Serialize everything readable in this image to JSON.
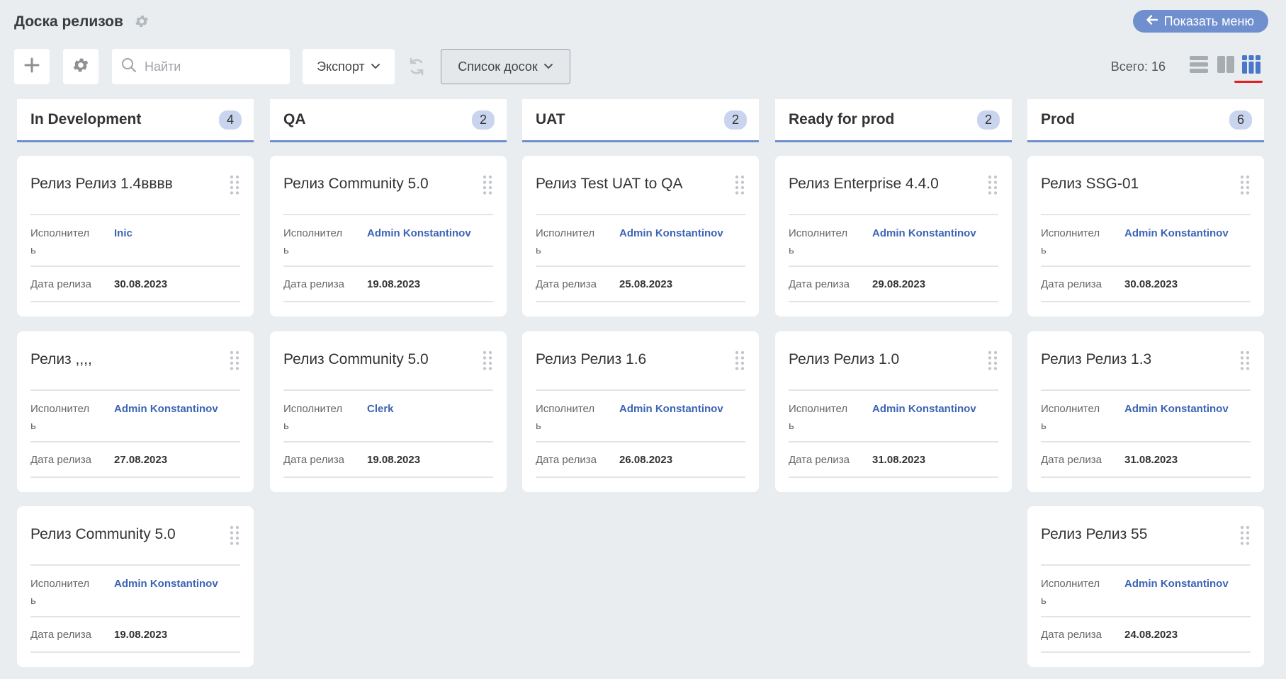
{
  "header": {
    "title": "Доска релизов",
    "show_menu_label": "Показать меню"
  },
  "toolbar": {
    "search_placeholder": "Найти",
    "export_label": "Экспорт",
    "boards_label": "Список досок",
    "total_label": "Всего: 16"
  },
  "labels": {
    "assignee": "Исполнител ь",
    "assignee_line1": "Исполнител",
    "assignee_line2": "ь",
    "release_date": "Дата релиза"
  },
  "columns": [
    {
      "title": "In Development",
      "count": "4",
      "cards": [
        {
          "title": "Релиз Релиз 1.4вввв",
          "assignee": "Inic",
          "date": "30.08.2023"
        },
        {
          "title": "Релиз ,,,,",
          "assignee": "Admin Konstantinov",
          "date": "27.08.2023"
        },
        {
          "title": "Релиз Community 5.0",
          "assignee": "Admin Konstantinov",
          "date": "19.08.2023"
        }
      ]
    },
    {
      "title": "QA",
      "count": "2",
      "cards": [
        {
          "title": "Релиз Community 5.0",
          "assignee": "Admin Konstantinov",
          "date": "19.08.2023"
        },
        {
          "title": "Релиз Community 5.0",
          "assignee": "Clerk",
          "date": "19.08.2023"
        }
      ]
    },
    {
      "title": "UAT",
      "count": "2",
      "cards": [
        {
          "title": "Релиз Test UAT to QA",
          "assignee": "Admin Konstantinov",
          "date": "25.08.2023"
        },
        {
          "title": "Релиз Релиз 1.6",
          "assignee": "Admin Konstantinov",
          "date": "26.08.2023"
        }
      ]
    },
    {
      "title": "Ready for prod",
      "count": "2",
      "cards": [
        {
          "title": "Релиз Enterprise 4.4.0",
          "assignee": "Admin Konstantinov",
          "date": "29.08.2023"
        },
        {
          "title": "Релиз Релиз 1.0",
          "assignee": "Admin Konstantinov",
          "date": "31.08.2023"
        }
      ]
    },
    {
      "title": "Prod",
      "count": "6",
      "cards": [
        {
          "title": "Релиз SSG-01",
          "assignee": "Admin Konstantinov",
          "date": "30.08.2023"
        },
        {
          "title": "Релиз Релиз 1.3",
          "assignee": "Admin Konstantinov",
          "date": "31.08.2023"
        },
        {
          "title": "Релиз Релиз 55",
          "assignee": "Admin Konstantinov",
          "date": "24.08.2023"
        }
      ]
    }
  ],
  "colors": {
    "accent": "#6f8fcf",
    "badge": "#c9d5ee",
    "link": "#3c64b4",
    "active_view": "#e02020"
  },
  "icons": [
    "gear-icon",
    "arrow-left-icon",
    "plus-icon",
    "settings-icon",
    "search-icon",
    "chevron-down-icon",
    "refresh-icon",
    "list-view-icon",
    "two-column-view-icon",
    "board-view-icon",
    "drag-handle-icon"
  ]
}
